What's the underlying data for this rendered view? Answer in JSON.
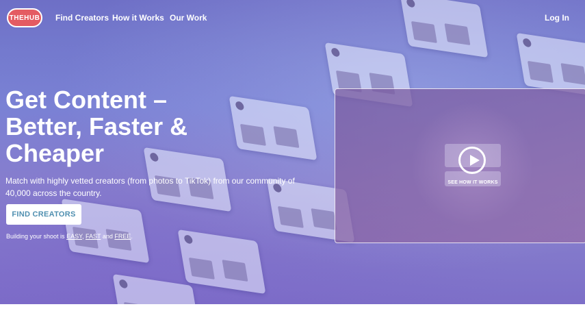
{
  "nav": {
    "logo_text": "THEHUB",
    "links": [
      "Find Creators",
      "How it Works",
      "Our Work"
    ],
    "login": "Log In"
  },
  "hero": {
    "headline": "Get Content – Better, Faster & Cheaper",
    "subtext": "Match with highly vetted creators (from photos to TikTok) from our community of 40,000 across the country.",
    "cta_label": "FIND CREATORS",
    "note_prefix": "Building your shoot is",
    "note_easy": "EASY",
    "note_sep1": ",",
    "note_fast": "FAST",
    "note_and": "and",
    "note_free": "FREE",
    "note_end": "."
  },
  "video": {
    "label": "SEE HOW IT WORKS"
  },
  "colors": {
    "logo_red": "#e45b62",
    "cta_text": "#4f8fb0"
  }
}
